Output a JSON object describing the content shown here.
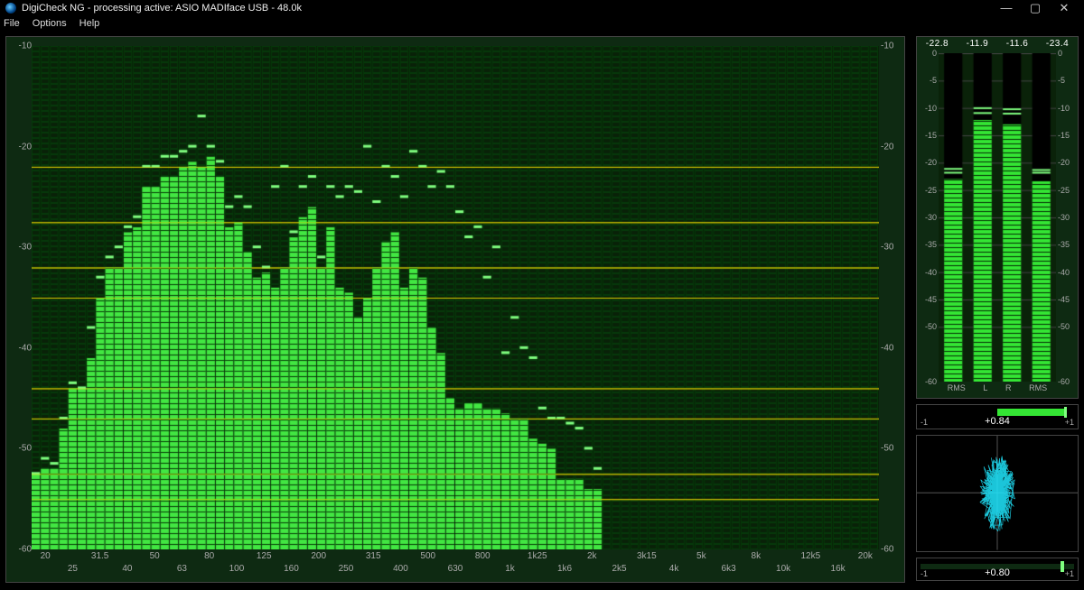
{
  "window": {
    "title": "DigiCheck NG - processing active: ASIO MADIface USB - 48.0k",
    "btn_min": "—",
    "btn_max": "▢",
    "btn_close": "✕"
  },
  "menu": {
    "file": "File",
    "options": "Options",
    "help": "Help"
  },
  "chart_data": {
    "type": "bar",
    "ylim": [
      -60,
      -10
    ],
    "y_ticks": [
      -10,
      -20,
      -30,
      -40,
      -50,
      -60
    ],
    "x_major": [
      "20",
      "31.5",
      "50",
      "80",
      "125",
      "200",
      "315",
      "500",
      "800",
      "1k25",
      "2k",
      "3k15",
      "5k",
      "8k",
      "12k5",
      "20k"
    ],
    "x_minor": [
      "25",
      "40",
      "63",
      "100",
      "160",
      "250",
      "400",
      "630",
      "1k",
      "1k6",
      "2k5",
      "4k",
      "6k3",
      "10k",
      "16k"
    ],
    "hlines_yellow": [
      -22,
      -27.5,
      -32,
      -35,
      -44,
      -47,
      -52.5,
      -55
    ],
    "bars": [
      {
        "v": -52.5,
        "p": -52.5
      },
      {
        "v": -52,
        "p": -51
      },
      {
        "v": -52,
        "p": -51.5
      },
      {
        "v": -48,
        "p": -47
      },
      {
        "v": -44,
        "p": -43.5
      },
      {
        "v": -44,
        "p": -44
      },
      {
        "v": -41,
        "p": -38
      },
      {
        "v": -35,
        "p": -33
      },
      {
        "v": -32,
        "p": -31
      },
      {
        "v": -32,
        "p": -30
      },
      {
        "v": -28.5,
        "p": -28
      },
      {
        "v": -28,
        "p": -27
      },
      {
        "v": -24,
        "p": -22
      },
      {
        "v": -24,
        "p": -22
      },
      {
        "v": -23,
        "p": -21
      },
      {
        "v": -23,
        "p": -21
      },
      {
        "v": -22,
        "p": -20.5
      },
      {
        "v": -21.5,
        "p": -20
      },
      {
        "v": -22,
        "p": -17
      },
      {
        "v": -21,
        "p": -20
      },
      {
        "v": -23,
        "p": -21.5
      },
      {
        "v": -28,
        "p": -26
      },
      {
        "v": -27.5,
        "p": -25
      },
      {
        "v": -30.5,
        "p": -26
      },
      {
        "v": -33,
        "p": -30
      },
      {
        "v": -32.5,
        "p": -32
      },
      {
        "v": -34,
        "p": -24
      },
      {
        "v": -32,
        "p": -22
      },
      {
        "v": -29,
        "p": -28.5
      },
      {
        "v": -27,
        "p": -24
      },
      {
        "v": -26,
        "p": -23
      },
      {
        "v": -32,
        "p": -31
      },
      {
        "v": -28,
        "p": -24
      },
      {
        "v": -34,
        "p": -25
      },
      {
        "v": -34.5,
        "p": -24
      },
      {
        "v": -37,
        "p": -24.5
      },
      {
        "v": -35,
        "p": -20
      },
      {
        "v": -32,
        "p": -25.5
      },
      {
        "v": -29.5,
        "p": -22
      },
      {
        "v": -28.5,
        "p": -23
      },
      {
        "v": -34,
        "p": -25
      },
      {
        "v": -32,
        "p": -20.5
      },
      {
        "v": -33,
        "p": -22
      },
      {
        "v": -38,
        "p": -24
      },
      {
        "v": -40.5,
        "p": -22.5
      },
      {
        "v": -45,
        "p": -24
      },
      {
        "v": -46,
        "p": -26.5
      },
      {
        "v": -45.5,
        "p": -29
      },
      {
        "v": -45.5,
        "p": -28
      },
      {
        "v": -46,
        "p": -33
      },
      {
        "v": -46,
        "p": -30
      },
      {
        "v": -46.5,
        "p": -40.5
      },
      {
        "v": -47,
        "p": -37
      },
      {
        "v": -47,
        "p": -40
      },
      {
        "v": -49,
        "p": -41
      },
      {
        "v": -49.5,
        "p": -46
      },
      {
        "v": -50,
        "p": -47
      },
      {
        "v": -53,
        "p": -47
      },
      {
        "v": -53,
        "p": -47.5
      },
      {
        "v": -53,
        "p": -48
      },
      {
        "v": -54,
        "p": -50
      },
      {
        "v": -54,
        "p": -52
      },
      {
        "v": null,
        "p": null
      },
      {
        "v": null,
        "p": null
      },
      {
        "v": null,
        "p": null
      },
      {
        "v": null,
        "p": null
      },
      {
        "v": null,
        "p": null
      },
      {
        "v": null,
        "p": null
      },
      {
        "v": null,
        "p": null
      },
      {
        "v": null,
        "p": null
      },
      {
        "v": null,
        "p": null
      },
      {
        "v": null,
        "p": null
      },
      {
        "v": null,
        "p": null
      },
      {
        "v": null,
        "p": null
      },
      {
        "v": null,
        "p": null
      },
      {
        "v": null,
        "p": null
      },
      {
        "v": null,
        "p": null
      },
      {
        "v": null,
        "p": null
      },
      {
        "v": null,
        "p": null
      },
      {
        "v": null,
        "p": null
      },
      {
        "v": null,
        "p": null
      },
      {
        "v": null,
        "p": null
      },
      {
        "v": null,
        "p": null
      },
      {
        "v": null,
        "p": null
      },
      {
        "v": null,
        "p": null
      },
      {
        "v": null,
        "p": null
      },
      {
        "v": null,
        "p": null
      },
      {
        "v": null,
        "p": null
      },
      {
        "v": null,
        "p": null
      },
      {
        "v": null,
        "p": null
      },
      {
        "v": null,
        "p": null
      },
      {
        "v": null,
        "p": null
      }
    ]
  },
  "level_meters": {
    "peaks": [
      "-22.8",
      "-11.9",
      "-11.6",
      "-23.4"
    ],
    "labels": [
      "RMS",
      "L",
      "R",
      "RMS"
    ],
    "ylim": [
      -60,
      0
    ],
    "y_ticks": [
      0,
      -5,
      -10,
      -15,
      -20,
      -25,
      -30,
      -35,
      -40,
      -45,
      -50,
      -60
    ],
    "bars": [
      {
        "v": -23,
        "p": -22,
        "p2": -21.3
      },
      {
        "v": -12.2,
        "p": -11.1,
        "p2": -10.2
      },
      {
        "v": -13.0,
        "p": -11.2,
        "p2": -10.4
      },
      {
        "v": -23.4,
        "p": -22.0,
        "p2": -21.5
      }
    ]
  },
  "correlation": {
    "min": "-1",
    "max": "+1",
    "value": "+0.84",
    "value_num": 0.84
  },
  "gonio_slider": {
    "min": "-1",
    "max": "+1",
    "value": "+0.80",
    "value_num": 0.8
  }
}
